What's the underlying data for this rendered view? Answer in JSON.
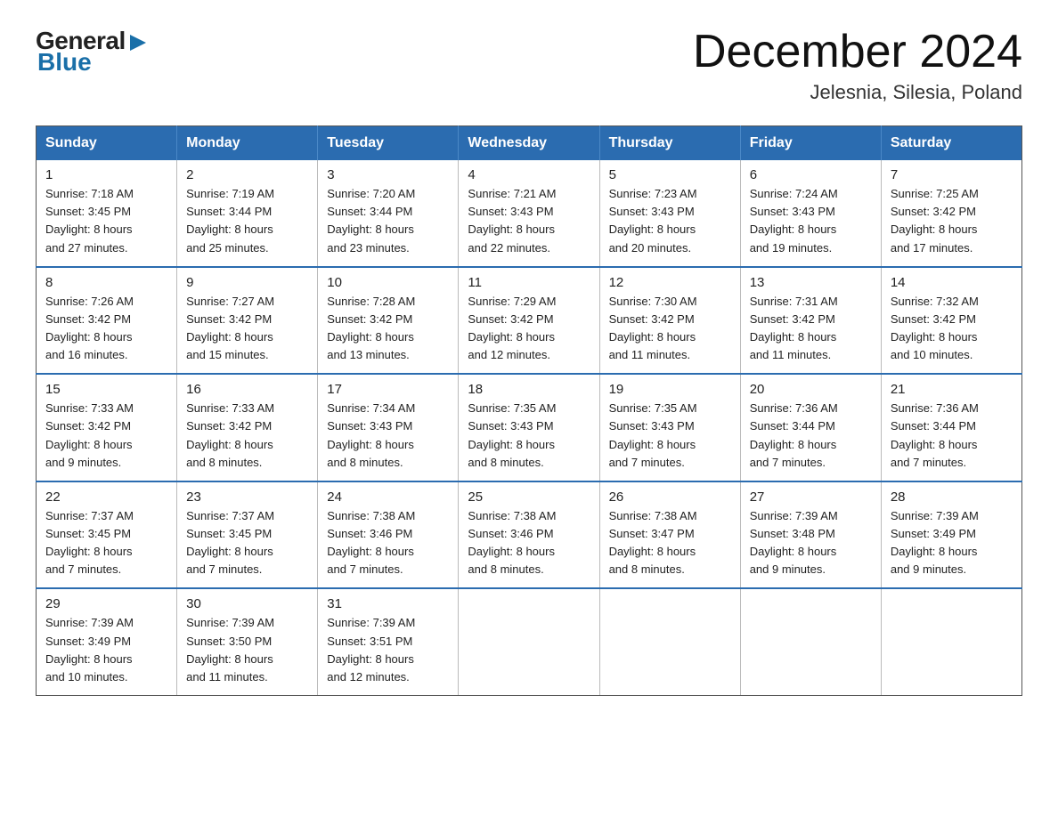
{
  "header": {
    "logo_general": "General",
    "logo_blue": "Blue",
    "month_title": "December 2024",
    "location": "Jelesnia, Silesia, Poland"
  },
  "weekdays": [
    "Sunday",
    "Monday",
    "Tuesday",
    "Wednesday",
    "Thursday",
    "Friday",
    "Saturday"
  ],
  "weeks": [
    [
      {
        "day": "1",
        "sunrise": "7:18 AM",
        "sunset": "3:45 PM",
        "daylight": "8 hours and 27 minutes."
      },
      {
        "day": "2",
        "sunrise": "7:19 AM",
        "sunset": "3:44 PM",
        "daylight": "8 hours and 25 minutes."
      },
      {
        "day": "3",
        "sunrise": "7:20 AM",
        "sunset": "3:44 PM",
        "daylight": "8 hours and 23 minutes."
      },
      {
        "day": "4",
        "sunrise": "7:21 AM",
        "sunset": "3:43 PM",
        "daylight": "8 hours and 22 minutes."
      },
      {
        "day": "5",
        "sunrise": "7:23 AM",
        "sunset": "3:43 PM",
        "daylight": "8 hours and 20 minutes."
      },
      {
        "day": "6",
        "sunrise": "7:24 AM",
        "sunset": "3:43 PM",
        "daylight": "8 hours and 19 minutes."
      },
      {
        "day": "7",
        "sunrise": "7:25 AM",
        "sunset": "3:42 PM",
        "daylight": "8 hours and 17 minutes."
      }
    ],
    [
      {
        "day": "8",
        "sunrise": "7:26 AM",
        "sunset": "3:42 PM",
        "daylight": "8 hours and 16 minutes."
      },
      {
        "day": "9",
        "sunrise": "7:27 AM",
        "sunset": "3:42 PM",
        "daylight": "8 hours and 15 minutes."
      },
      {
        "day": "10",
        "sunrise": "7:28 AM",
        "sunset": "3:42 PM",
        "daylight": "8 hours and 13 minutes."
      },
      {
        "day": "11",
        "sunrise": "7:29 AM",
        "sunset": "3:42 PM",
        "daylight": "8 hours and 12 minutes."
      },
      {
        "day": "12",
        "sunrise": "7:30 AM",
        "sunset": "3:42 PM",
        "daylight": "8 hours and 11 minutes."
      },
      {
        "day": "13",
        "sunrise": "7:31 AM",
        "sunset": "3:42 PM",
        "daylight": "8 hours and 11 minutes."
      },
      {
        "day": "14",
        "sunrise": "7:32 AM",
        "sunset": "3:42 PM",
        "daylight": "8 hours and 10 minutes."
      }
    ],
    [
      {
        "day": "15",
        "sunrise": "7:33 AM",
        "sunset": "3:42 PM",
        "daylight": "8 hours and 9 minutes."
      },
      {
        "day": "16",
        "sunrise": "7:33 AM",
        "sunset": "3:42 PM",
        "daylight": "8 hours and 8 minutes."
      },
      {
        "day": "17",
        "sunrise": "7:34 AM",
        "sunset": "3:43 PM",
        "daylight": "8 hours and 8 minutes."
      },
      {
        "day": "18",
        "sunrise": "7:35 AM",
        "sunset": "3:43 PM",
        "daylight": "8 hours and 8 minutes."
      },
      {
        "day": "19",
        "sunrise": "7:35 AM",
        "sunset": "3:43 PM",
        "daylight": "8 hours and 7 minutes."
      },
      {
        "day": "20",
        "sunrise": "7:36 AM",
        "sunset": "3:44 PM",
        "daylight": "8 hours and 7 minutes."
      },
      {
        "day": "21",
        "sunrise": "7:36 AM",
        "sunset": "3:44 PM",
        "daylight": "8 hours and 7 minutes."
      }
    ],
    [
      {
        "day": "22",
        "sunrise": "7:37 AM",
        "sunset": "3:45 PM",
        "daylight": "8 hours and 7 minutes."
      },
      {
        "day": "23",
        "sunrise": "7:37 AM",
        "sunset": "3:45 PM",
        "daylight": "8 hours and 7 minutes."
      },
      {
        "day": "24",
        "sunrise": "7:38 AM",
        "sunset": "3:46 PM",
        "daylight": "8 hours and 7 minutes."
      },
      {
        "day": "25",
        "sunrise": "7:38 AM",
        "sunset": "3:46 PM",
        "daylight": "8 hours and 8 minutes."
      },
      {
        "day": "26",
        "sunrise": "7:38 AM",
        "sunset": "3:47 PM",
        "daylight": "8 hours and 8 minutes."
      },
      {
        "day": "27",
        "sunrise": "7:39 AM",
        "sunset": "3:48 PM",
        "daylight": "8 hours and 9 minutes."
      },
      {
        "day": "28",
        "sunrise": "7:39 AM",
        "sunset": "3:49 PM",
        "daylight": "8 hours and 9 minutes."
      }
    ],
    [
      {
        "day": "29",
        "sunrise": "7:39 AM",
        "sunset": "3:49 PM",
        "daylight": "8 hours and 10 minutes."
      },
      {
        "day": "30",
        "sunrise": "7:39 AM",
        "sunset": "3:50 PM",
        "daylight": "8 hours and 11 minutes."
      },
      {
        "day": "31",
        "sunrise": "7:39 AM",
        "sunset": "3:51 PM",
        "daylight": "8 hours and 12 minutes."
      },
      null,
      null,
      null,
      null
    ]
  ],
  "labels": {
    "sunrise": "Sunrise:",
    "sunset": "Sunset:",
    "daylight": "Daylight:"
  }
}
